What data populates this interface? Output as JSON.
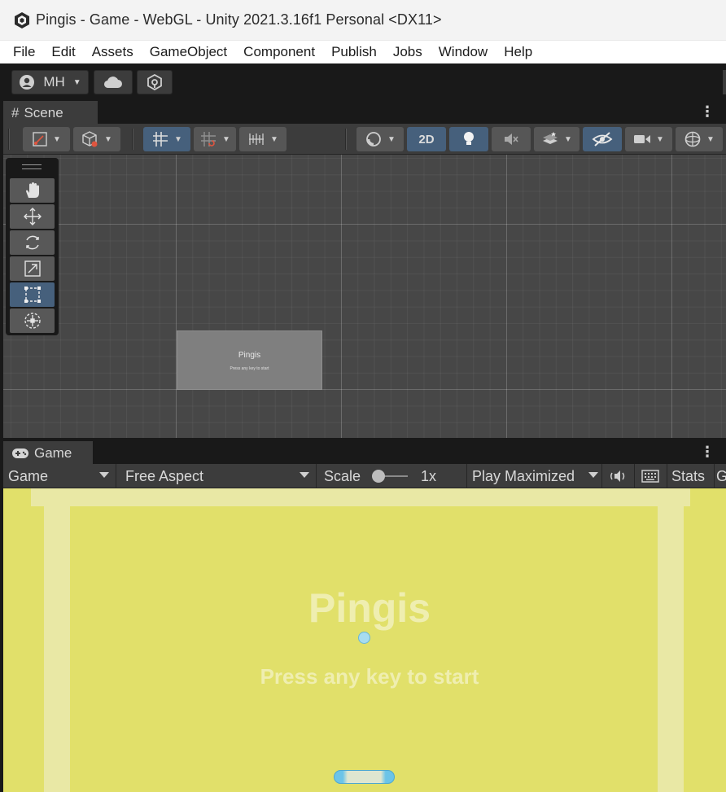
{
  "window": {
    "title": "Pingis - Game - WebGL - Unity 2021.3.16f1 Personal <DX11>"
  },
  "menu": [
    "File",
    "Edit",
    "Assets",
    "GameObject",
    "Component",
    "Publish",
    "Jobs",
    "Window",
    "Help"
  ],
  "toolbar": {
    "account_label": "MH",
    "account_icon": "user-circle-icon",
    "cloud_icon": "cloud-icon",
    "collab_icon": "unity-services-icon"
  },
  "scene": {
    "tab_label": "Scene",
    "tab_icon": "hash-icon",
    "mode_2d_label": "2D",
    "tools": [
      "hand-tool",
      "move-tool",
      "rotate-tool",
      "scale-tool",
      "rect-tool",
      "transform-tool"
    ],
    "active_tool": "rect-tool",
    "canvas_title": "Pingis",
    "canvas_subtitle": "Press any key to start"
  },
  "game": {
    "tab_label": "Game",
    "tab_icon": "gamepad-icon",
    "display_label": "Game",
    "aspect_label": "Free Aspect",
    "scale_label": "Scale",
    "scale_value": "1x",
    "play_mode_label": "Play Maximized",
    "stats_label": "Stats",
    "title_text": "Pingis",
    "subtitle_text": "Press any key to start",
    "colors": {
      "background": "#e1e06a",
      "walls": "#e9e8a5",
      "text": "#efeeb0",
      "ball": "#a7dcf0",
      "paddle": "#6cc4e8"
    }
  }
}
